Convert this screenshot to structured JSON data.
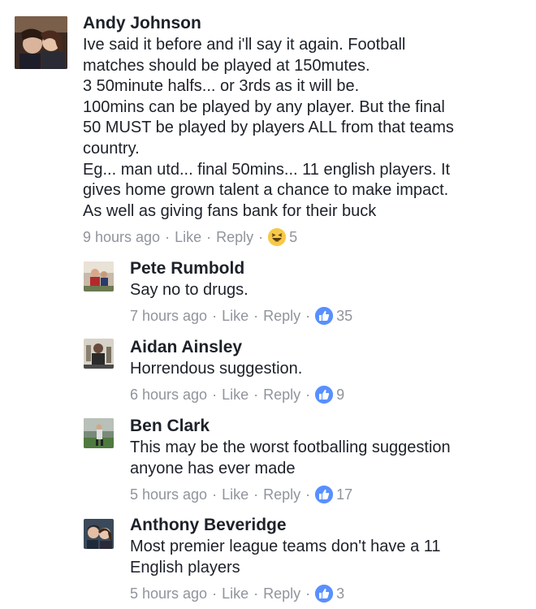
{
  "comments": [
    {
      "name": "Andy Johnson",
      "lines": [
        "Ive said it before and i'll say it again. Football",
        "matches should be played at 150mutes.",
        "3 50minute halfs... or 3rds as it will be.",
        "100mins can be played by any player. But the final",
        "50 MUST be played by players ALL from that teams",
        "country.",
        "Eg... man utd... final 50mins... 11 english players. It",
        "gives home grown talent a chance to make impact.",
        "As well as giving fans bank for their buck"
      ],
      "time": "9 hours ago",
      "like": "Like",
      "reply": "Reply",
      "reaction_icon": "haha-icon",
      "count": "5"
    },
    {
      "name": "Pete Rumbold",
      "lines": [
        "Say no to drugs."
      ],
      "time": "7 hours ago",
      "like": "Like",
      "reply": "Reply",
      "reaction_icon": "like-icon",
      "count": "35"
    },
    {
      "name": "Aidan Ainsley",
      "lines": [
        "Horrendous suggestion."
      ],
      "time": "6 hours ago",
      "like": "Like",
      "reply": "Reply",
      "reaction_icon": "like-icon",
      "count": "9"
    },
    {
      "name": "Ben Clark",
      "lines": [
        "This may be the worst footballing suggestion",
        "anyone has ever made"
      ],
      "time": "5 hours ago",
      "like": "Like",
      "reply": "Reply",
      "reaction_icon": "like-icon",
      "count": "17"
    },
    {
      "name": "Anthony Beveridge",
      "lines": [
        "Most premier league teams don't have a 11",
        "English players"
      ],
      "time": "5 hours ago",
      "like": "Like",
      "reply": "Reply",
      "reaction_icon": "like-icon",
      "count": "3"
    }
  ],
  "separator": "·",
  "colors": {
    "name": "#1d2129",
    "meta": "#90949c",
    "like_blue": "#5890ff",
    "haha_yellow": "#f7c948"
  }
}
